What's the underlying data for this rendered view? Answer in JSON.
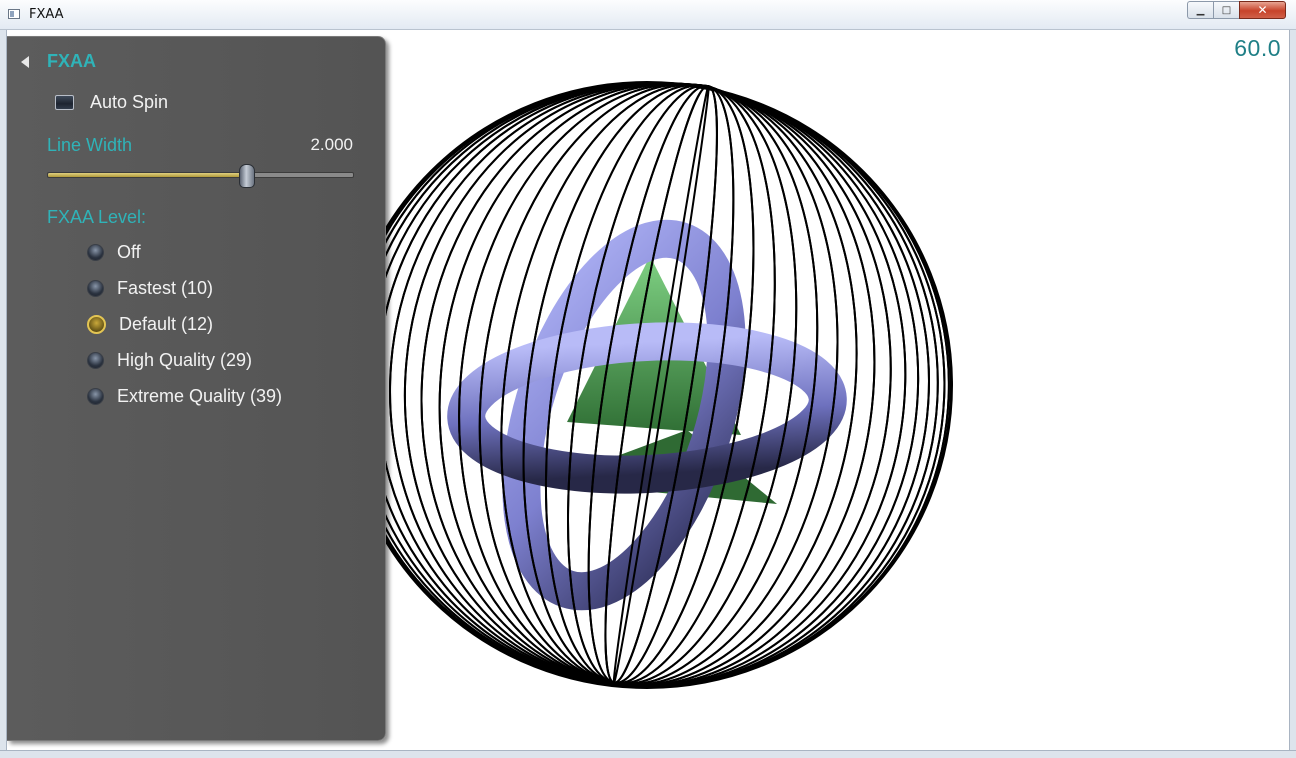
{
  "window": {
    "title": "FXAA",
    "controls": {
      "minimize": "▁",
      "maximize": "□",
      "close": "✕"
    }
  },
  "fps": "60.0",
  "panel": {
    "title": "FXAA",
    "auto_spin": {
      "label": "Auto Spin",
      "checked": false
    },
    "line_width": {
      "label": "Line Width",
      "value": "2.000",
      "fraction": 0.65
    },
    "fxaa_level": {
      "label": "FXAA Level:",
      "options": [
        {
          "label": "Off",
          "selected": false
        },
        {
          "label": "Fastest (10)",
          "selected": false
        },
        {
          "label": "Default (12)",
          "selected": true
        },
        {
          "label": "High Quality (29)",
          "selected": false
        },
        {
          "label": "Extreme Quality (39)",
          "selected": false
        }
      ]
    }
  },
  "colors": {
    "accent_teal": "#2fb3b8",
    "torus": "#8f93e0",
    "pyramid": "#5fb863",
    "wire": "#000000"
  }
}
